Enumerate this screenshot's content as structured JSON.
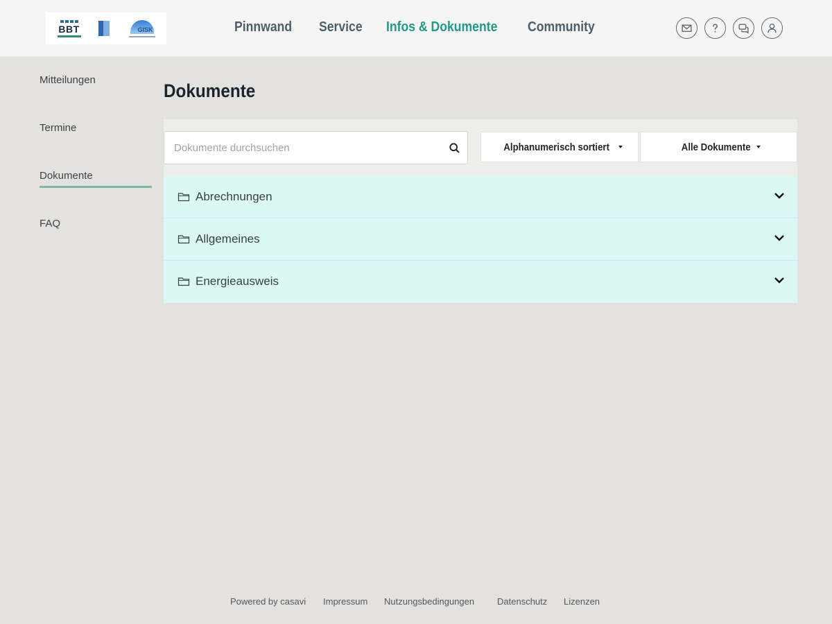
{
  "header": {
    "logo": {
      "bbt": "BBT",
      "gisk": "GISK"
    },
    "nav": [
      {
        "label": "Pinnwand",
        "active": false
      },
      {
        "label": "Service",
        "active": false
      },
      {
        "label": "Infos & Dokumente",
        "active": true
      },
      {
        "label": "Community",
        "active": false
      }
    ],
    "icons": [
      "mail-icon",
      "help-icon",
      "chat-icon",
      "user-icon"
    ]
  },
  "sidebar": {
    "items": [
      {
        "label": "Mitteilungen",
        "active": false
      },
      {
        "label": "Termine",
        "active": false
      },
      {
        "label": "Dokumente",
        "active": true
      },
      {
        "label": "FAQ",
        "active": false
      }
    ]
  },
  "main": {
    "title": "Dokumente",
    "search": {
      "placeholder": "Dokumente durchsuchen",
      "value": ""
    },
    "sort_label": "Alphanumerisch sortiert",
    "filter_label": "Alle Dokumente",
    "folders": [
      {
        "label": "Abrechnungen"
      },
      {
        "label": "Allgemeines"
      },
      {
        "label": "Energieausweis"
      }
    ]
  },
  "footer": {
    "links": [
      "Powered by casavi",
      "Impressum",
      "Nutzungsbedingungen",
      "Datenschutz",
      "Lizenzen"
    ]
  },
  "colors": {
    "accent": "#1f9a86",
    "page_bg": "#e3e2df",
    "folder_bg": "#dbf8f7"
  }
}
